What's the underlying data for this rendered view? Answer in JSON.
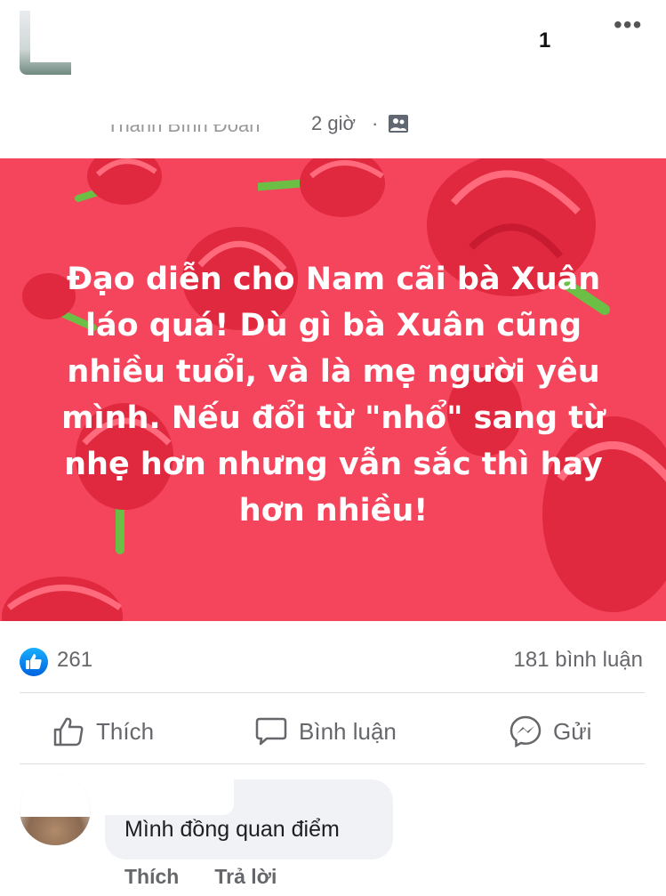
{
  "header": {
    "counter": "1",
    "author": "Thanh Bình Đoàn",
    "timestamp": "2 giờ",
    "separator": "·",
    "audience_icon": "friends-icon"
  },
  "post": {
    "background": "#f4455d",
    "text": "Đạo diễn cho Nam cãi bà Xuân láo quá! Dù gì bà Xuân cũng nhiều tuổi, và là mẹ người yêu mình. Nếu đổi từ \"nhổ\" sang từ nhẹ hơn nhưng vẫn sắc thì hay hơn nhiều!"
  },
  "stats": {
    "likes": "261",
    "comments": "181 bình luận"
  },
  "actions": {
    "like": "Thích",
    "comment": "Bình luận",
    "share": "Gửi"
  },
  "comment": {
    "text": "Mình đồng quan điểm",
    "like": "Thích",
    "reply": "Trả lời"
  },
  "colors": {
    "accent": "#1877f2",
    "muted": "#65676b"
  }
}
